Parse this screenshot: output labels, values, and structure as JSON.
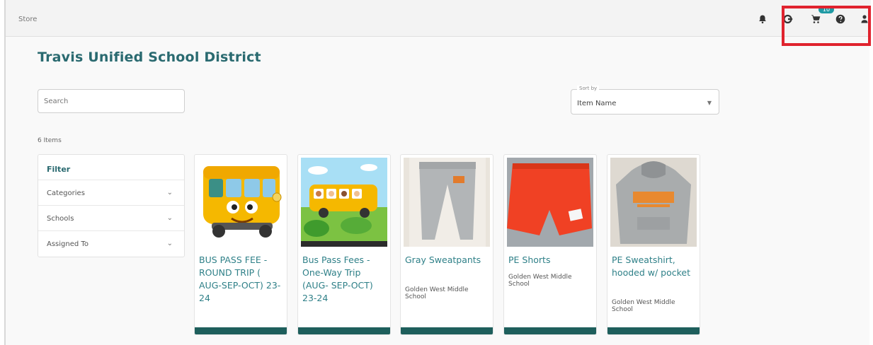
{
  "header": {
    "breadcrumb": "Store",
    "cart_badge": "10",
    "icons": [
      "bell-icon",
      "logout-icon",
      "cart-icon",
      "help-icon",
      "user-icon"
    ]
  },
  "page": {
    "title": "Travis Unified School District"
  },
  "search": {
    "placeholder": "Search"
  },
  "sort": {
    "label": "Sort by",
    "value": "Item Name"
  },
  "items_count": "6 Items",
  "filter": {
    "title": "Filter",
    "rows": [
      {
        "label": "Categories"
      },
      {
        "label": "Schools"
      },
      {
        "label": "Assigned To"
      }
    ]
  },
  "products": [
    {
      "name": "BUS PASS FEE - ROUND TRIP ( AUG-SEP-OCT) 23-24",
      "school": ""
    },
    {
      "name": "Bus Pass Fees - One-Way Trip (AUG- SEP-OCT) 23-24",
      "school": ""
    },
    {
      "name": "Gray Sweatpants",
      "school": "Golden West Middle School"
    },
    {
      "name": "PE Shorts",
      "school": "Golden West Middle School"
    },
    {
      "name": "PE Sweatshirt, hooded w/ pocket",
      "school": "Golden West Middle School"
    }
  ],
  "colors": {
    "accent": "#2a6a70",
    "product_bar": "#1e5f5c",
    "badge": "#1f9aa4",
    "highlight": "#e0232e"
  }
}
